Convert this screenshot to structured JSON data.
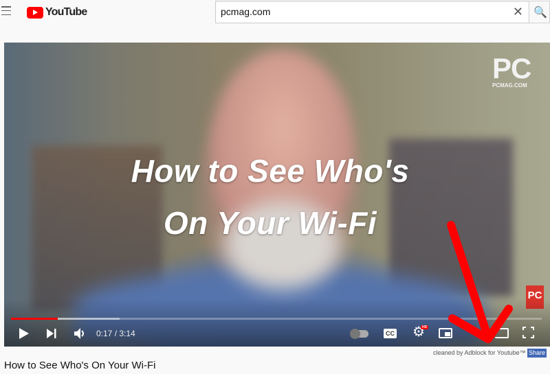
{
  "header": {
    "logo_text": "YouTube",
    "search_value": "pcmag.com",
    "clear_icon": "✕",
    "search_icon": "🔍"
  },
  "video": {
    "overlay_line1": "How to See Who's",
    "overlay_line2": "On Your Wi-Fi",
    "watermark_big": "PC",
    "watermark_small": "PCMAG.COM",
    "corner_badge": "PC",
    "current_time": "0:17",
    "duration": "3:14",
    "time_display": "0:17 / 3:14",
    "progress_fraction": 0.088,
    "buffered_fraction": 0.205,
    "cc_label": "CC",
    "hd_badge": "HD",
    "progress_color": "#ff0000"
  },
  "below": {
    "credit": "cleaned by Adblock for Youtube™",
    "share_label": "Share",
    "title": "How to See Who's On Your Wi-Fi"
  },
  "annotation": {
    "arrow_color": "#ff0000"
  }
}
